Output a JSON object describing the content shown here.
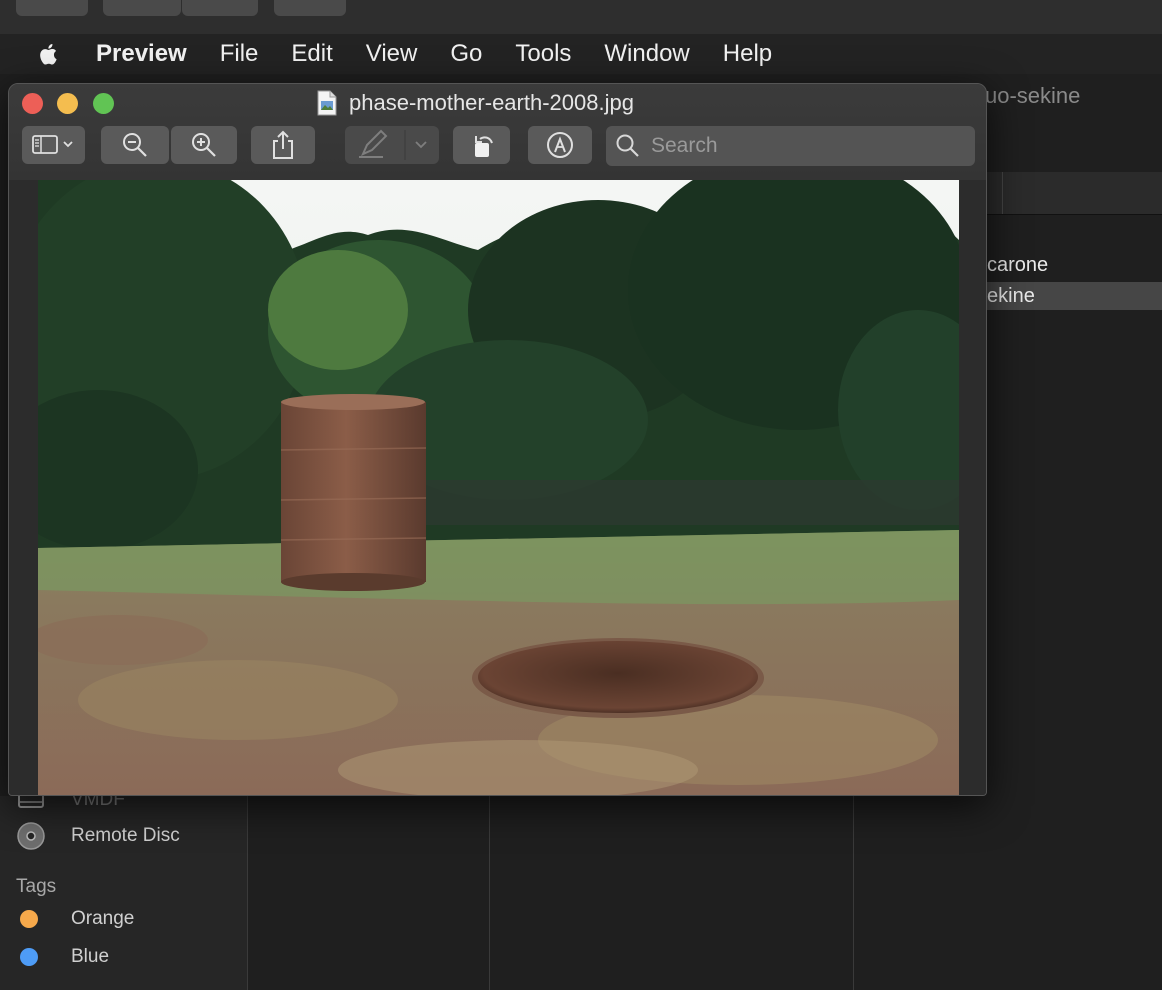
{
  "menubar": {
    "app_name": "Preview",
    "items": [
      "File",
      "Edit",
      "View",
      "Go",
      "Tools",
      "Window",
      "Help"
    ]
  },
  "preview_window": {
    "title": "phase-mother-earth-2008.jpg",
    "search_placeholder": "Search",
    "toolbar_buttons": [
      "sidebar-toggle",
      "zoom-out",
      "zoom-in",
      "share",
      "markup-highlight",
      "rotate-left",
      "markup-toolbar"
    ]
  },
  "background_window": {
    "title_fragment": "uo-sekine",
    "list_items": [
      {
        "label": "carone",
        "selected": false
      },
      {
        "label": "ekine",
        "selected": true
      }
    ]
  },
  "sidebar": {
    "partial_item": "VMDF",
    "remote_disc": "Remote Disc",
    "tags_header": "Tags",
    "tags": [
      {
        "label": "Orange",
        "color": "#f6a94b"
      },
      {
        "label": "Blue",
        "color": "#4e9cf6"
      }
    ]
  }
}
